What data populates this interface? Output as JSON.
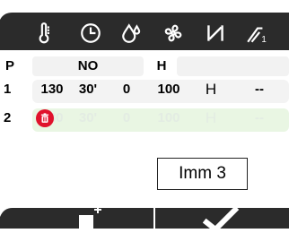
{
  "header": {
    "icons": [
      "thermometer-icon",
      "clock-icon",
      "humidity-icon",
      "fan-icon",
      "interval-icon",
      "step-icon"
    ]
  },
  "table": {
    "columns": [
      "P",
      "NO",
      "H"
    ],
    "rows": [
      {
        "index": "1",
        "value1": "130",
        "value2": "30'",
        "value3": "0",
        "value4": "100",
        "symbol": "H",
        "extra": "--"
      },
      {
        "index": "2",
        "value1": "130",
        "value2": "30'",
        "value3": "0",
        "value4": "100",
        "symbol": "H",
        "extra": "--"
      }
    ]
  },
  "label_box": {
    "text": "Imm 3"
  },
  "bottom": {
    "icons": [
      "add-step-icon",
      "confirm-icon"
    ]
  },
  "colors": {
    "bar": "#2b2b2b",
    "delete_red": "#e0122c",
    "row_highlight": "#e9f6e3"
  }
}
